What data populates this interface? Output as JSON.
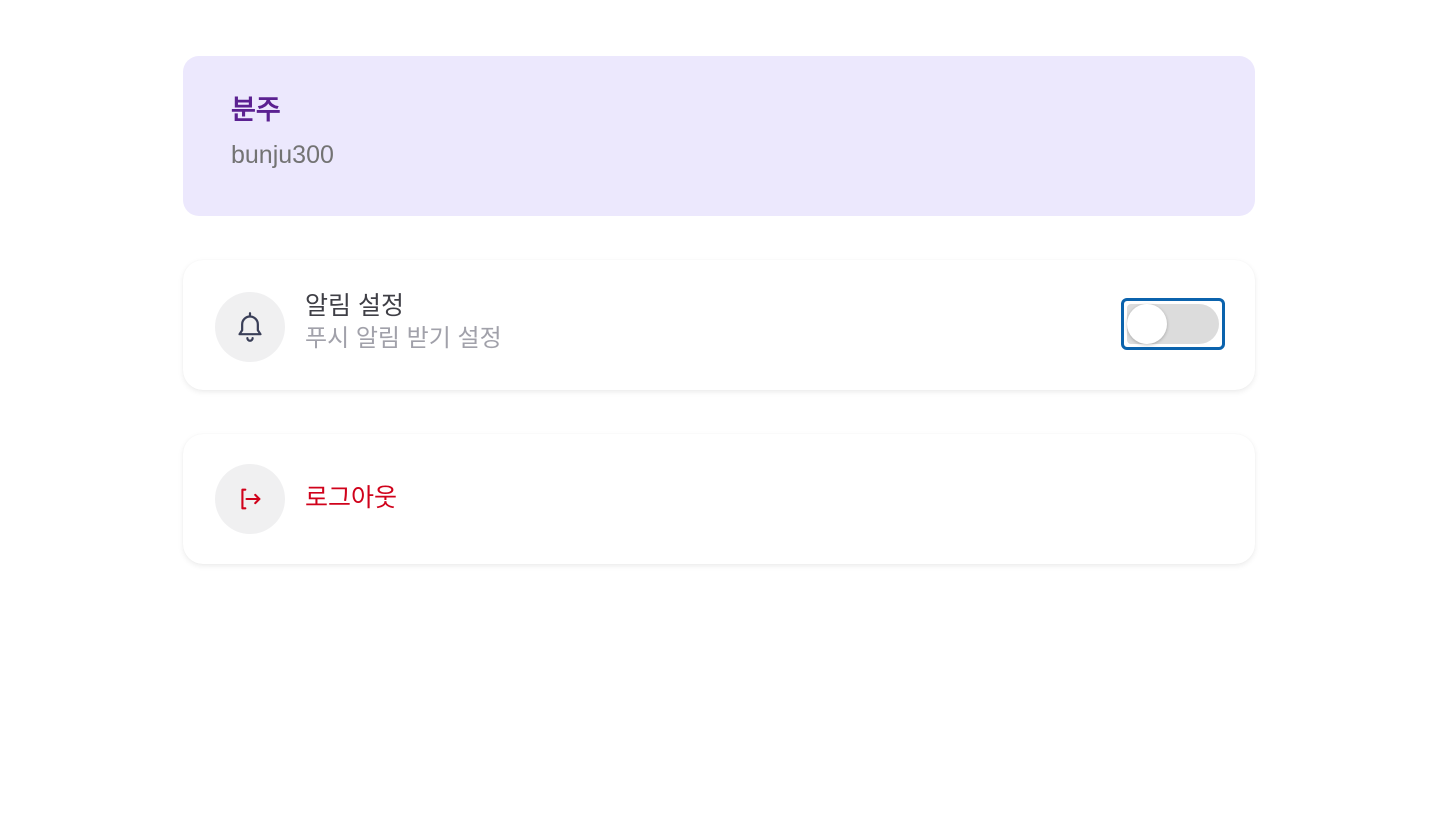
{
  "profile": {
    "name": "분주",
    "user_id": "bunju300"
  },
  "notifications": {
    "icon": "bell-icon",
    "title": "알림 설정",
    "subtitle": "푸시 알림 받기 설정",
    "toggle_on": false
  },
  "logout": {
    "icon": "logout-icon",
    "label": "로그아웃",
    "color": "#d0021b"
  },
  "colors": {
    "profile_bg": "#ece8fd",
    "profile_name": "#5b2191",
    "toggle_focus": "#0b63ad"
  }
}
